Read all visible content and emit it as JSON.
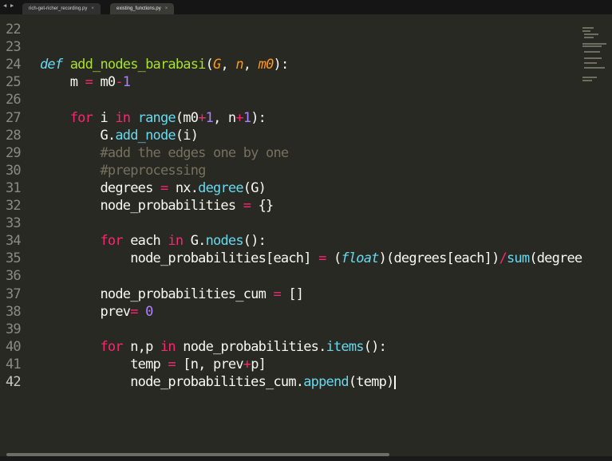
{
  "tabs": [
    {
      "label": "rich-get-richer_recording.py",
      "close": "×",
      "active": false
    },
    {
      "label": "existing_functions.py",
      "close": "×",
      "active": true
    }
  ],
  "nav": {
    "back_glyph": "◀",
    "forward_glyph": "▶"
  },
  "lines": [
    {
      "n": "22",
      "tokens": []
    },
    {
      "n": "23",
      "tokens": []
    },
    {
      "n": "24",
      "tokens": [
        [
          "def",
          "def"
        ],
        [
          "txt",
          " "
        ],
        [
          "fn",
          "add_nodes_barabasi"
        ],
        [
          "txt",
          "("
        ],
        [
          "param",
          "G"
        ],
        [
          "txt",
          ", "
        ],
        [
          "param",
          "n"
        ],
        [
          "txt",
          ", "
        ],
        [
          "param",
          "m0"
        ],
        [
          "txt",
          "):"
        ]
      ]
    },
    {
      "n": "25",
      "tokens": [
        [
          "txt",
          "    m "
        ],
        [
          "kw",
          "="
        ],
        [
          "txt",
          " m0"
        ],
        [
          "kw",
          "-"
        ],
        [
          "num",
          "1"
        ]
      ]
    },
    {
      "n": "26",
      "tokens": []
    },
    {
      "n": "27",
      "tokens": [
        [
          "txt",
          "    "
        ],
        [
          "kw",
          "for"
        ],
        [
          "txt",
          " i "
        ],
        [
          "kw",
          "in"
        ],
        [
          "txt",
          " "
        ],
        [
          "bi",
          "range"
        ],
        [
          "txt",
          "(m0"
        ],
        [
          "kw",
          "+"
        ],
        [
          "num",
          "1"
        ],
        [
          "txt",
          ", n"
        ],
        [
          "kw",
          "+"
        ],
        [
          "num",
          "1"
        ],
        [
          "txt",
          "):"
        ]
      ]
    },
    {
      "n": "28",
      "tokens": [
        [
          "txt",
          "        G."
        ],
        [
          "bi",
          "add_node"
        ],
        [
          "txt",
          "(i)"
        ]
      ]
    },
    {
      "n": "29",
      "tokens": [
        [
          "txt",
          "        "
        ],
        [
          "cmt",
          "#add the edges one by one"
        ]
      ]
    },
    {
      "n": "30",
      "tokens": [
        [
          "txt",
          "        "
        ],
        [
          "cmt",
          "#preprocessing"
        ]
      ]
    },
    {
      "n": "31",
      "tokens": [
        [
          "txt",
          "        degrees "
        ],
        [
          "kw",
          "="
        ],
        [
          "txt",
          " nx."
        ],
        [
          "bi",
          "degree"
        ],
        [
          "txt",
          "(G)"
        ]
      ]
    },
    {
      "n": "32",
      "tokens": [
        [
          "txt",
          "        node_probabilities "
        ],
        [
          "kw",
          "="
        ],
        [
          "txt",
          " {}"
        ]
      ]
    },
    {
      "n": "33",
      "tokens": []
    },
    {
      "n": "34",
      "tokens": [
        [
          "txt",
          "        "
        ],
        [
          "kw",
          "for"
        ],
        [
          "txt",
          " each "
        ],
        [
          "kw",
          "in"
        ],
        [
          "txt",
          " G."
        ],
        [
          "bi",
          "nodes"
        ],
        [
          "txt",
          "():"
        ]
      ]
    },
    {
      "n": "35",
      "tokens": [
        [
          "txt",
          "            node_probabilities[each] "
        ],
        [
          "kw",
          "="
        ],
        [
          "txt",
          " ("
        ],
        [
          "def",
          "float"
        ],
        [
          "txt",
          ")(degrees[each])"
        ],
        [
          "kw",
          "/"
        ],
        [
          "bi",
          "sum"
        ],
        [
          "txt",
          "(degree"
        ]
      ]
    },
    {
      "n": "36",
      "tokens": []
    },
    {
      "n": "37",
      "tokens": [
        [
          "txt",
          "        node_probabilities_cum "
        ],
        [
          "kw",
          "="
        ],
        [
          "txt",
          " []"
        ]
      ]
    },
    {
      "n": "38",
      "tokens": [
        [
          "txt",
          "        prev"
        ],
        [
          "kw",
          "="
        ],
        [
          "txt",
          " "
        ],
        [
          "num",
          "0"
        ]
      ]
    },
    {
      "n": "39",
      "tokens": []
    },
    {
      "n": "40",
      "tokens": [
        [
          "txt",
          "        "
        ],
        [
          "kw",
          "for"
        ],
        [
          "txt",
          " n,p "
        ],
        [
          "kw",
          "in"
        ],
        [
          "txt",
          " node_probabilities."
        ],
        [
          "bi",
          "items"
        ],
        [
          "txt",
          "():"
        ]
      ]
    },
    {
      "n": "41",
      "tokens": [
        [
          "txt",
          "            temp "
        ],
        [
          "kw",
          "="
        ],
        [
          "txt",
          " [n, prev"
        ],
        [
          "kw",
          "+"
        ],
        [
          "txt",
          "p]"
        ]
      ]
    },
    {
      "n": "42",
      "tokens": [
        [
          "txt",
          "            node_probabilities_cum."
        ],
        [
          "bi",
          "append"
        ],
        [
          "txt",
          "(temp)"
        ]
      ],
      "current": true
    }
  ],
  "colors": {
    "background": "#282923",
    "keyword": "#f92672",
    "storage": "#66d9ef",
    "function": "#a6e22e",
    "parameter": "#fd971f",
    "number": "#ae81ff",
    "comment": "#75715e",
    "text": "#f8f8f2"
  }
}
